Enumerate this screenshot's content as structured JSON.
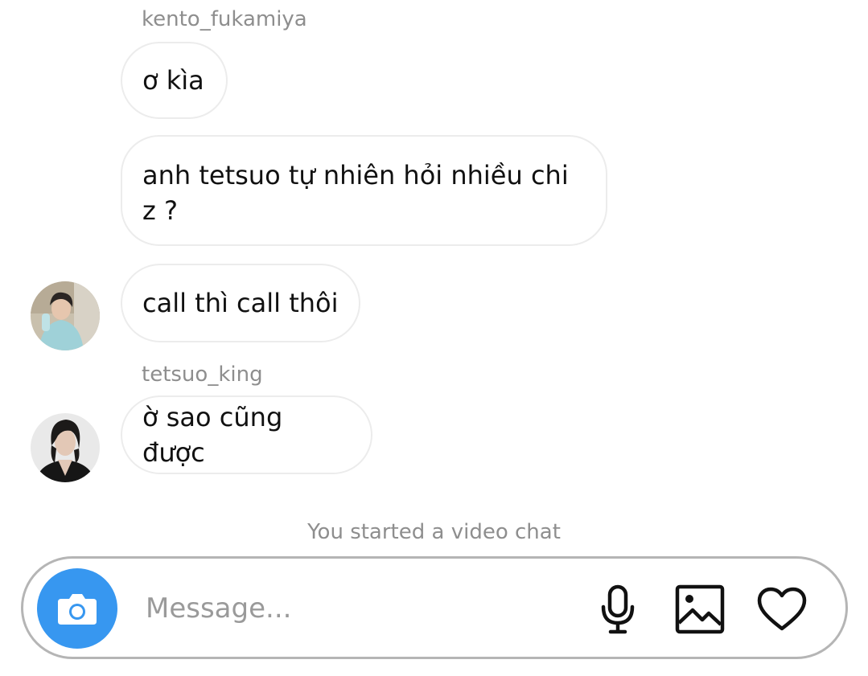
{
  "thread": {
    "groups": [
      {
        "sender": "kento_fukamiya",
        "messages": [
          "ơ kìa",
          "anh tetsuo tự nhiên hỏi nhiều chi\nz ?",
          "call thì call thôi"
        ]
      },
      {
        "sender": "tetsuo_king",
        "messages": [
          "ờ sao cũng được"
        ]
      }
    ],
    "system_message": "You started a video chat"
  },
  "composer": {
    "placeholder": "Message...",
    "camera_icon": "camera-icon",
    "mic_icon": "microphone-icon",
    "gallery_icon": "image-icon",
    "like_icon": "heart-icon",
    "accent_color": "#3797f0"
  }
}
